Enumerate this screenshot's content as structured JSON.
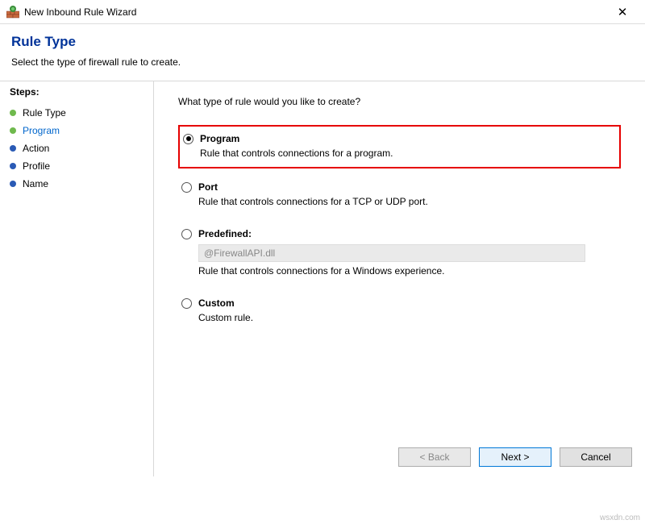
{
  "window": {
    "title": "New Inbound Rule Wizard",
    "close": "✕"
  },
  "header": {
    "title": "Rule Type",
    "subtitle": "Select the type of firewall rule to create."
  },
  "sidebar": {
    "heading": "Steps:",
    "items": [
      {
        "label": "Rule Type",
        "bullet": "done",
        "current": false
      },
      {
        "label": "Program",
        "bullet": "done",
        "current": true
      },
      {
        "label": "Action",
        "bullet": "pending",
        "current": false
      },
      {
        "label": "Profile",
        "bullet": "pending",
        "current": false
      },
      {
        "label": "Name",
        "bullet": "pending",
        "current": false
      }
    ]
  },
  "main": {
    "question": "What type of rule would you like to create?",
    "options": [
      {
        "title": "Program",
        "desc": "Rule that controls connections for a program.",
        "checked": true,
        "highlight": true
      },
      {
        "title": "Port",
        "desc": "Rule that controls connections for a TCP or UDP port.",
        "checked": false
      },
      {
        "title": "Predefined:",
        "desc": "Rule that controls connections for a Windows experience.",
        "checked": false,
        "select_value": "@FirewallAPI.dll"
      },
      {
        "title": "Custom",
        "desc": "Custom rule.",
        "checked": false
      }
    ]
  },
  "buttons": {
    "back": "< Back",
    "next": "Next >",
    "cancel": "Cancel"
  },
  "watermark": "wsxdn.com"
}
